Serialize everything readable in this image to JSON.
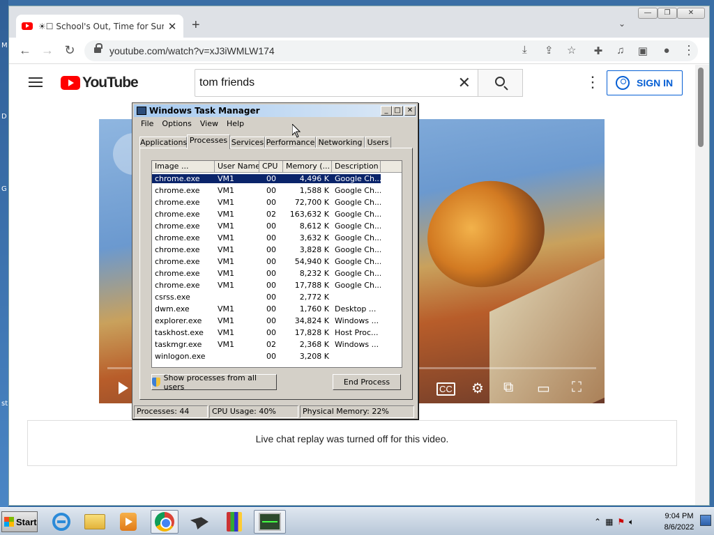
{
  "desktop": {
    "letters": [
      "M",
      "D",
      "G",
      "st"
    ]
  },
  "browser": {
    "tab_title": "☀☐ School's Out, Time for Summer",
    "tab_close": "✕",
    "new_tab": "+",
    "tab_search_chevron": "⌄",
    "url": "youtube.com/watch?v=xJ3iWMLW174",
    "window_buttons": {
      "minimize": "—",
      "restore": "❐",
      "close": "✕"
    }
  },
  "youtube": {
    "logo_text": "YouTube",
    "search_value": "tom friends",
    "search_clear": "✕",
    "more": "⋮",
    "sign_in": "SIGN IN",
    "live_chat_message": "Live chat replay was turned off for this video."
  },
  "task_manager": {
    "title": "Windows Task Manager",
    "menu": [
      "File",
      "Options",
      "View",
      "Help"
    ],
    "tabs": [
      "Applications",
      "Processes",
      "Services",
      "Performance",
      "Networking",
      "Users"
    ],
    "active_tab": "Processes",
    "columns": [
      "Image ...",
      "User Name",
      "CPU",
      "Memory (...",
      "Description"
    ],
    "rows": [
      [
        "chrome.exe",
        "VM1",
        "00",
        "4,496 K",
        "Google Ch..."
      ],
      [
        "chrome.exe",
        "VM1",
        "00",
        "1,588 K",
        "Google Ch..."
      ],
      [
        "chrome.exe",
        "VM1",
        "00",
        "72,700 K",
        "Google Ch..."
      ],
      [
        "chrome.exe",
        "VM1",
        "02",
        "163,632 K",
        "Google Ch..."
      ],
      [
        "chrome.exe",
        "VM1",
        "00",
        "8,612 K",
        "Google Ch..."
      ],
      [
        "chrome.exe",
        "VM1",
        "00",
        "3,632 K",
        "Google Ch..."
      ],
      [
        "chrome.exe",
        "VM1",
        "00",
        "3,828 K",
        "Google Ch..."
      ],
      [
        "chrome.exe",
        "VM1",
        "00",
        "54,940 K",
        "Google Ch..."
      ],
      [
        "chrome.exe",
        "VM1",
        "00",
        "8,232 K",
        "Google Ch..."
      ],
      [
        "chrome.exe",
        "VM1",
        "00",
        "17,788 K",
        "Google Ch..."
      ],
      [
        "csrss.exe",
        "",
        "00",
        "2,772 K",
        ""
      ],
      [
        "dwm.exe",
        "VM1",
        "00",
        "1,760 K",
        "Desktop ..."
      ],
      [
        "explorer.exe",
        "VM1",
        "00",
        "34,824 K",
        "Windows ..."
      ],
      [
        "taskhost.exe",
        "VM1",
        "00",
        "17,828 K",
        "Host Proc..."
      ],
      [
        "taskmgr.exe",
        "VM1",
        "02",
        "2,368 K",
        "Windows ..."
      ],
      [
        "winlogon.exe",
        "",
        "00",
        "3,208 K",
        ""
      ]
    ],
    "show_all_button": "Show processes from all users",
    "end_process_button": "End Process",
    "status": {
      "processes": "Processes: 44",
      "cpu": "CPU Usage: 40%",
      "memory": "Physical Memory: 22%"
    }
  },
  "taskbar": {
    "start": "Start",
    "time": "9:04 PM",
    "date": "8/6/2022"
  }
}
